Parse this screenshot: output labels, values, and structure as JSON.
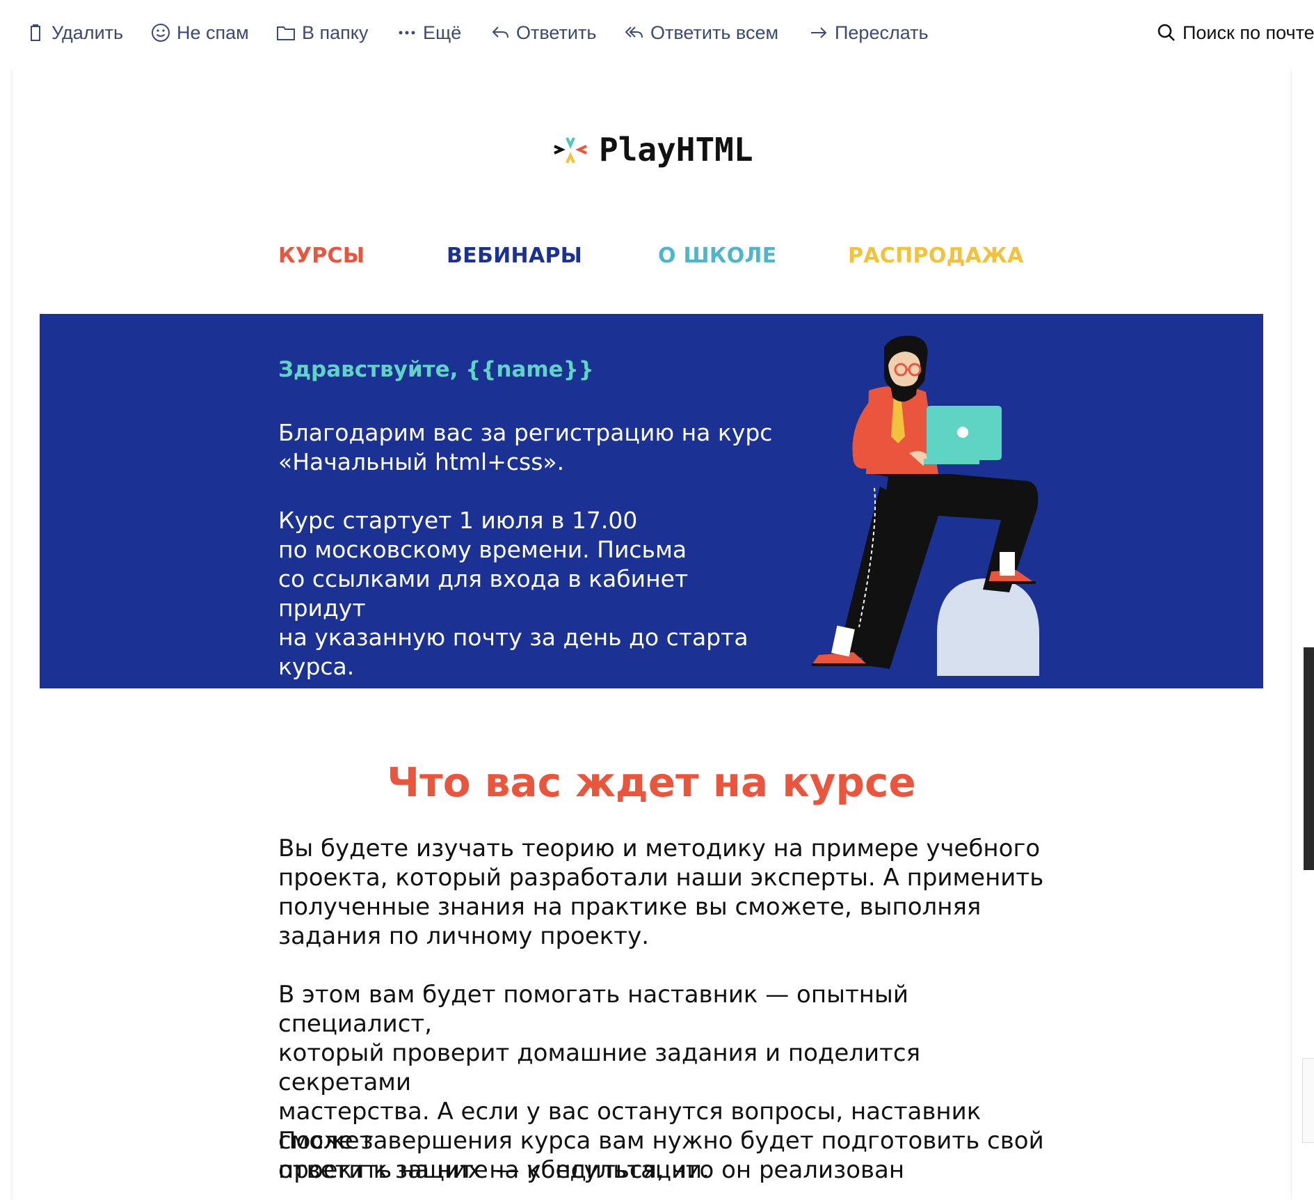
{
  "toolbar": {
    "delete": "Удалить",
    "not_spam": "Не спам",
    "to_folder": "В папку",
    "more": "Ещё",
    "reply": "Ответить",
    "reply_all": "Ответить всем",
    "forward": "Переслать",
    "search": "Поиск по почте"
  },
  "email": {
    "logo": "PlayHTML",
    "nav": [
      {
        "label": "КУРСЫ",
        "color": "#e9553d"
      },
      {
        "label": "ВЕБИНАРЫ",
        "color": "#1b3294"
      },
      {
        "label": "О ШКОЛЕ",
        "color": "#4fb6c9"
      },
      {
        "label": "РАСПРОДАЖА",
        "color": "#f2c13d"
      }
    ],
    "banner": {
      "greeting": "Здравствуйте, {{name}}",
      "p1": [
        "Благодарим вас за регистрацию на курс",
        "«Начальный html+css»."
      ],
      "p2": [
        "Курс стартует 1 июля в 17.00",
        "по московскому времени. Письма",
        "со ссылками для входа в кабинет придут",
        "на указанную почту за день до старта",
        "курса."
      ]
    },
    "section_title": "Что вас ждет на курсе",
    "paragraphs": [
      [
        "Вы будете изучать теорию и методику на примере учебного",
        "проекта, который разработали наши эксперты. А применить",
        "полученные знания на практике вы сможете, выполняя",
        "задания по личному проекту."
      ],
      [
        "В этом вам будет помогать наставник — опытный специалист,",
        "который проверит домашние задания и поделится секретами",
        "мастерства. А если у вас останутся вопросы, наставник сможет",
        "ответить на них на консультации."
      ],
      [
        "После завершения курса вам нужно будет подготовить свой",
        "проект к защите — убедиться, что он реализован"
      ]
    ]
  },
  "colors": {
    "banner_bg": "#1b3294",
    "accent_red": "#e9553d",
    "greeting_teal": "#5fd3c4",
    "toolbar_text": "#3b4a72"
  }
}
